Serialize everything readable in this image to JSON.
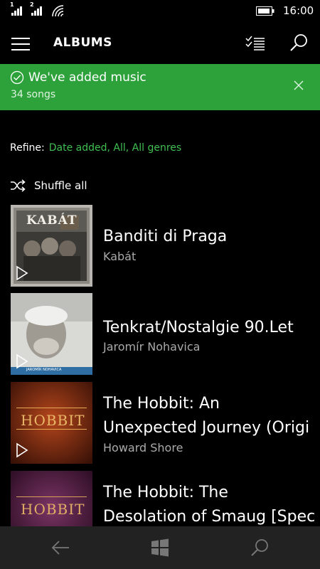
{
  "status": {
    "sim1": "1",
    "sim2": "2",
    "time": "16:00"
  },
  "header": {
    "title": "ALBUMS"
  },
  "banner": {
    "title": "We've added music",
    "subtitle": "34 songs"
  },
  "refine": {
    "label": "Refine:",
    "value": "Date added, All, All genres"
  },
  "shuffle": {
    "label": "Shuffle all"
  },
  "albums": [
    {
      "title": "Banditi di Praga",
      "artist": "Kabát",
      "art_text": "KABÁT"
    },
    {
      "title": "Tenkrat/Nostalgie 90.Let",
      "artist": "Jaromír Nohavica",
      "art_text": "JAROMÍR NOHAVICA"
    },
    {
      "title_line1": "The Hobbit: An",
      "title_line2": "Unexpected Journey (Origi",
      "artist": "Howard Shore",
      "art_text": "HOBBIT"
    },
    {
      "title_line1": "The Hobbit: The",
      "title_line2": "Desolation of Smaug [Spec",
      "art_text": "HOBBIT"
    }
  ],
  "colors": {
    "accent": "#2da23a",
    "link": "#3fbf52",
    "background": "#000000",
    "navbar": "#222222"
  },
  "icons": {
    "menu": "hamburger-icon",
    "select": "multi-select-icon",
    "search": "search-icon",
    "check": "check-circle-icon",
    "close": "close-icon",
    "shuffle": "shuffle-icon",
    "play": "play-icon",
    "back": "back-arrow-icon",
    "home": "windows-logo-icon"
  }
}
